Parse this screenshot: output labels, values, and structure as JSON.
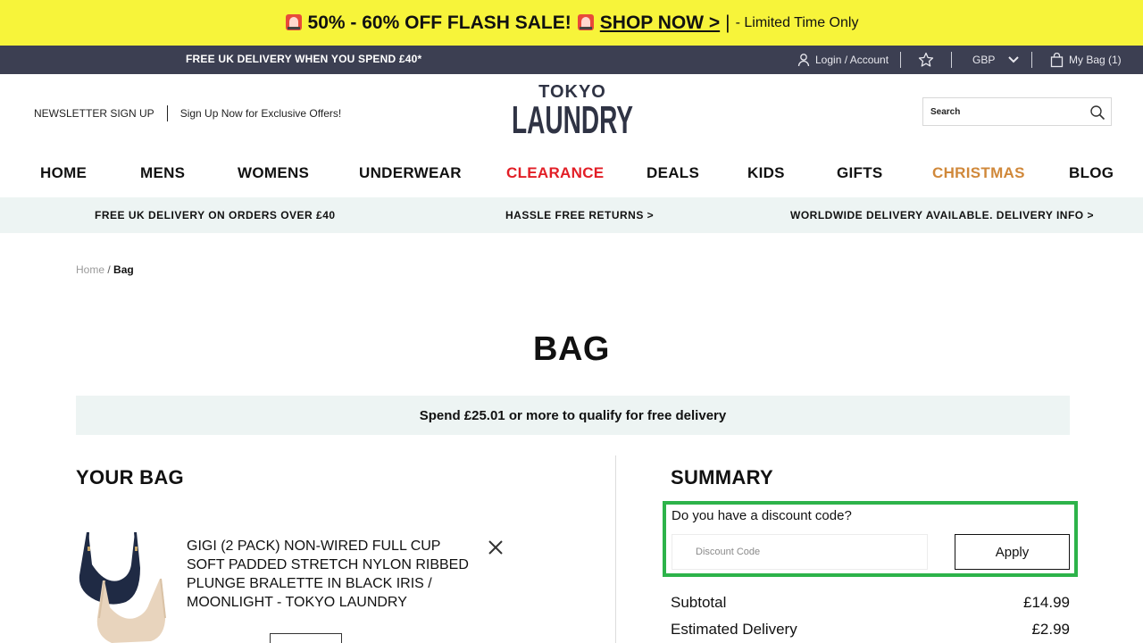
{
  "flash_bar": {
    "headline": "50% - 60% OFF FLASH SALE!",
    "cta": "SHOP NOW >",
    "divider": "|",
    "note": "- Limited Time Only",
    "icon": "siren-icon"
  },
  "utility_bar": {
    "promo": "FREE UK DELIVERY WHEN YOU SPEND £40*",
    "login": "Login / Account",
    "currency": "GBP",
    "bag": "My Bag (1)"
  },
  "header": {
    "newsletter_label": "NEWSLETTER SIGN UP",
    "newsletter_offer": "Sign Up Now for Exclusive Offers!",
    "logo_lines": [
      "TOKYO",
      "LAUNDRY"
    ],
    "search_placeholder": "Search"
  },
  "nav": {
    "items": [
      {
        "label": "HOME"
      },
      {
        "label": "MENS"
      },
      {
        "label": "WOMENS"
      },
      {
        "label": "UNDERWEAR"
      },
      {
        "label": "CLEARANCE",
        "color": "#e21e26"
      },
      {
        "label": "DEALS"
      },
      {
        "label": "KIDS"
      },
      {
        "label": "GIFTS"
      },
      {
        "label": "CHRISTMAS",
        "color": "#d0883a"
      },
      {
        "label": "BLOG"
      }
    ]
  },
  "usp_bar": {
    "items": [
      "FREE UK DELIVERY ON ORDERS OVER £40",
      "HASSLE FREE RETURNS >",
      "WORLDWIDE DELIVERY AVAILABLE. DELIVERY INFO >"
    ]
  },
  "breadcrumb": {
    "home": "Home",
    "separator": "/",
    "current": "Bag"
  },
  "page": {
    "title": "BAG",
    "delivery_message": "Spend £25.01 or more to qualify for free delivery"
  },
  "bag": {
    "heading": "YOUR BAG",
    "items": [
      {
        "name": "GIGI (2 PACK) NON-WIRED FULL CUP SOFT PADDED STRETCH NYLON RIBBED PLUNGE BRALETTE IN BLACK IRIS / MOONLIGHT - TOKYO LAUNDRY"
      }
    ]
  },
  "summary": {
    "heading": "SUMMARY",
    "discount_question": "Do you have a discount code?",
    "discount_placeholder": "Discount Code",
    "apply_label": "Apply",
    "highlight_color": "#2db34a",
    "rows": [
      {
        "label": "Subtotal",
        "value": "£14.99"
      },
      {
        "label": "Estimated Delivery",
        "value": "£2.99"
      }
    ]
  }
}
